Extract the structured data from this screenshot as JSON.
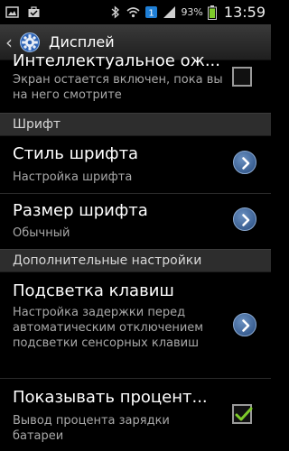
{
  "status_bar": {
    "icons": [
      "image-icon",
      "suitcase-icon",
      "usb-icon",
      "bluetooth-icon",
      "wifi-icon",
      "data-icon",
      "signal-icon",
      "battery-icon"
    ],
    "battery_percent": "93%",
    "time": "13:59"
  },
  "action_bar": {
    "title": "Дисплей"
  },
  "list": {
    "partial_item": {
      "title": "Интеллектуальное ож...",
      "summary": "Экран остается включен, пока вы на него смотрите",
      "checked": false
    },
    "section_font": "Шрифт",
    "font_style": {
      "title": "Стиль шрифта",
      "summary": "Настройка шрифта"
    },
    "font_size": {
      "title": "Размер шрифта",
      "summary": "Обычный"
    },
    "section_additional": "Дополнительные настройки",
    "key_backlight": {
      "title": "Подсветка клавиш",
      "summary": "Настройка задержки перед автоматическим отключением подсветки сенсорных клавиш"
    },
    "battery_percent": {
      "title": "Показывать процент...",
      "summary": "Вывод процента зарядки батареи",
      "checked": true
    }
  },
  "colors": {
    "accent_blue": "#3a5f92",
    "checkmark_green": "#7ecb2a",
    "section_bg": "#2d2d2d"
  }
}
